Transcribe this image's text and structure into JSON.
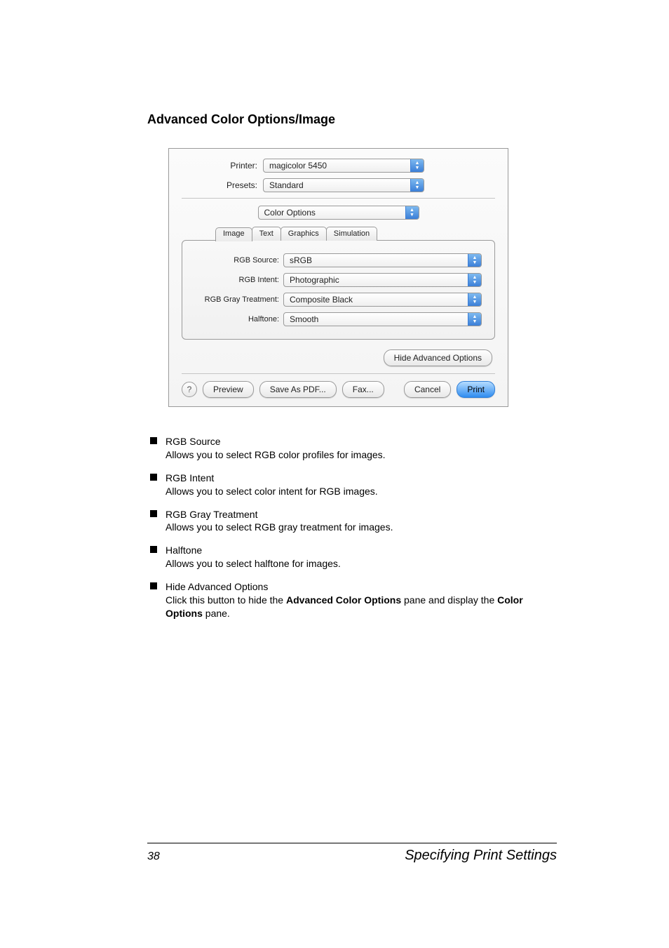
{
  "heading": "Advanced Color Options/Image",
  "dialog": {
    "printer_label": "Printer:",
    "printer_value": "magicolor 5450",
    "presets_label": "Presets:",
    "presets_value": "Standard",
    "pane_value": "Color Options",
    "tabs": {
      "image": "Image",
      "text": "Text",
      "graphics": "Graphics",
      "simulation": "Simulation"
    },
    "rgb_source_label": "RGB Source:",
    "rgb_source_value": "sRGB",
    "rgb_intent_label": "RGB Intent:",
    "rgb_intent_value": "Photographic",
    "rgb_gray_label": "RGB Gray Treatment:",
    "rgb_gray_value": "Composite Black",
    "halftone_label": "Halftone:",
    "halftone_value": "Smooth",
    "hide_advanced": "Hide Advanced Options",
    "help_glyph": "?",
    "preview": "Preview",
    "save_pdf": "Save As PDF...",
    "fax": "Fax...",
    "cancel": "Cancel",
    "print": "Print"
  },
  "items": [
    {
      "title": "RGB Source",
      "desc": "Allows you to select RGB color profiles for images."
    },
    {
      "title": "RGB Intent",
      "desc": "Allows you to select color intent for RGB images."
    },
    {
      "title": "RGB Gray Treatment",
      "desc": "Allows you to select RGB gray treatment for images."
    },
    {
      "title": "Halftone",
      "desc": "Allows you to select halftone for images."
    }
  ],
  "item_hide": {
    "title": "Hide Advanced Options",
    "pre": "Click this button to hide the ",
    "b1": "Advanced Color Options",
    "mid": " pane and display the ",
    "b2": "Color Options",
    "post": " pane."
  },
  "footer": {
    "page": "38",
    "title": "Specifying Print Settings"
  }
}
